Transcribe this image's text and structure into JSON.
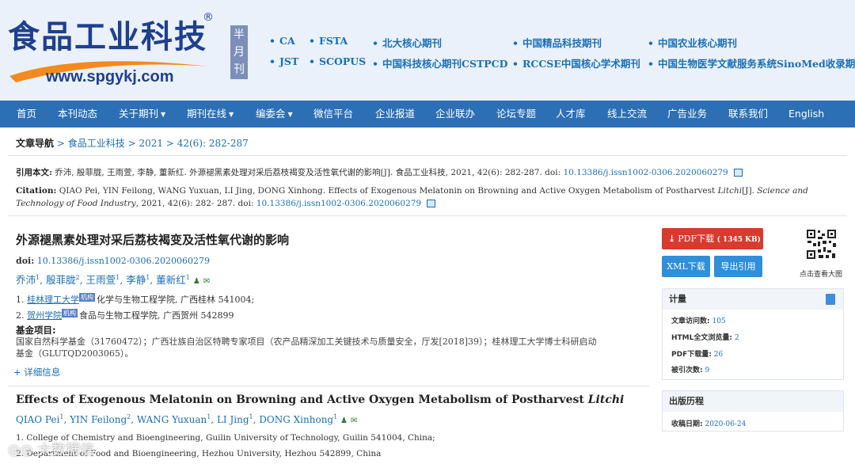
{
  "header": {
    "logo_title": "食品工业科技",
    "logo_reg": "®",
    "logo_url": "www.spgykj.com",
    "frequency": [
      "半",
      "月",
      "刊"
    ],
    "tags": [
      "CA",
      "FSTA",
      "北大核心期刊",
      "中国精品科技期刊",
      "中国农业核心期刊",
      "JST",
      "SCOPUS",
      "中国科技核心期刊CSTPCD",
      "RCCSE中国核心学术期刊",
      "中国生物医学文献服务系统SinoMed收录期刊"
    ]
  },
  "nav": [
    {
      "label": "首页",
      "caret": false
    },
    {
      "label": "本刊动态",
      "caret": false
    },
    {
      "label": "关于期刊",
      "caret": true
    },
    {
      "label": "期刊在线",
      "caret": true
    },
    {
      "label": "编委会",
      "caret": true
    },
    {
      "label": "微信平台",
      "caret": false
    },
    {
      "label": "企业报道",
      "caret": false
    },
    {
      "label": "企业联办",
      "caret": false
    },
    {
      "label": "论坛专题",
      "caret": false
    },
    {
      "label": "人才库",
      "caret": false
    },
    {
      "label": "线上交流",
      "caret": false
    },
    {
      "label": "广告业务",
      "caret": false
    },
    {
      "label": "联系我们",
      "caret": false
    },
    {
      "label": "English",
      "caret": false
    }
  ],
  "breadcrumb": {
    "label": "文章导航",
    "items": [
      "食品工业科技",
      "2021",
      "42(6): 282-287"
    ],
    "sep": ">"
  },
  "citation": {
    "cn_label": "引用本文:",
    "cn_text": "乔沛, 殷菲胧, 王雨萱, 李静, 董新红. 外源褪黑素处理对采后荔枝褐变及活性氧代谢的影响[J]. 食品工业科技, 2021, 42(6): 282-287. doi:",
    "cn_doi": "10.13386/j.issn1002-0306.2020060279",
    "en_label": "Citation:",
    "en_text_1": "QIAO Pei, YIN Feilong, WANG Yuxuan, LI Jing, DONG Xinhong. Effects of Exogenous Melatonin on Browning and Active Oxygen Metabolism of Postharvest",
    "en_italic_1": "Litchi",
    "en_text_2": "[J].",
    "en_italic_2": "Science and Technology of Food Industry",
    "en_text_3": ", 2021, 42(6): 282-",
    "en_text_4": "287. doi:",
    "en_doi": "10.13386/j.issn1002-0306.2020060279"
  },
  "article_cn": {
    "title": "外源褪黑素处理对采后荔枝褐变及活性氧代谢的影响",
    "doi_label": "doi:",
    "doi": "10.13386/j.issn1002-0306.2020060279",
    "authors": [
      {
        "name": "乔沛",
        "sup": "1"
      },
      {
        "name": "殷菲胧",
        "sup": "2"
      },
      {
        "name": "王雨萱",
        "sup": "1"
      },
      {
        "name": "李静",
        "sup": "1"
      },
      {
        "name": "董新红",
        "sup": "1"
      }
    ],
    "affiliations": [
      {
        "num": "1.",
        "inst": "桂林理工大学",
        "badge": "机构",
        "rest": "化学与生物工程学院, 广西桂林 541004;"
      },
      {
        "num": "2.",
        "inst": "贺州学院",
        "badge": "机构",
        "rest": "食品与生物工程学院, 广西贺州 542899"
      }
    ],
    "fund_label": "基金项目:",
    "fund_text": "国家自然科学基金（31760472）；广西壮族自治区特聘专家项目（农产品精深加工关键技术与质量安全，厅发[2018]39）；桂林理工大学博士科研启动基金（GLUTQD2003065）。",
    "more_info": "+ 详细信息"
  },
  "article_en": {
    "title": "Effects of Exogenous Melatonin on Browning and Active Oxygen Metabolism of Postharvest",
    "title_italic": "Litchi",
    "authors": [
      {
        "name": "QIAO Pei",
        "sup": "1"
      },
      {
        "name": "YIN Feilong",
        "sup": "2"
      },
      {
        "name": "WANG Yuxuan",
        "sup": "1"
      },
      {
        "name": "LI Jing",
        "sup": "1"
      },
      {
        "name": "DONG Xinhong",
        "sup": "1"
      }
    ],
    "affiliations": [
      "1. College of Chemistry and Bioengineering, Guilin University of Technology, Guilin 541004, China;",
      "2. Department of Food and Bioengineering, Hezhou University, Hezhou 542899, China"
    ]
  },
  "actions": {
    "pdf_label": "PDF下载",
    "pdf_size": "( 1345 KB)",
    "xml_label": "XML下载",
    "ref_label": "导出引用",
    "qr_caption": "点击查看大图"
  },
  "metrics": {
    "title": "计量",
    "rows": [
      {
        "k": "文章访问数:",
        "v": "105"
      },
      {
        "k": "HTML全文浏览量:",
        "v": "2"
      },
      {
        "k": "PDF下载量:",
        "v": "26"
      },
      {
        "k": "被引次数:",
        "v": "9"
      }
    ]
  },
  "history": {
    "title": "出版历程",
    "rows": [
      {
        "k": "收稿日期:",
        "v": "2020-06-24"
      }
    ]
  },
  "watermark": "大数据信"
}
